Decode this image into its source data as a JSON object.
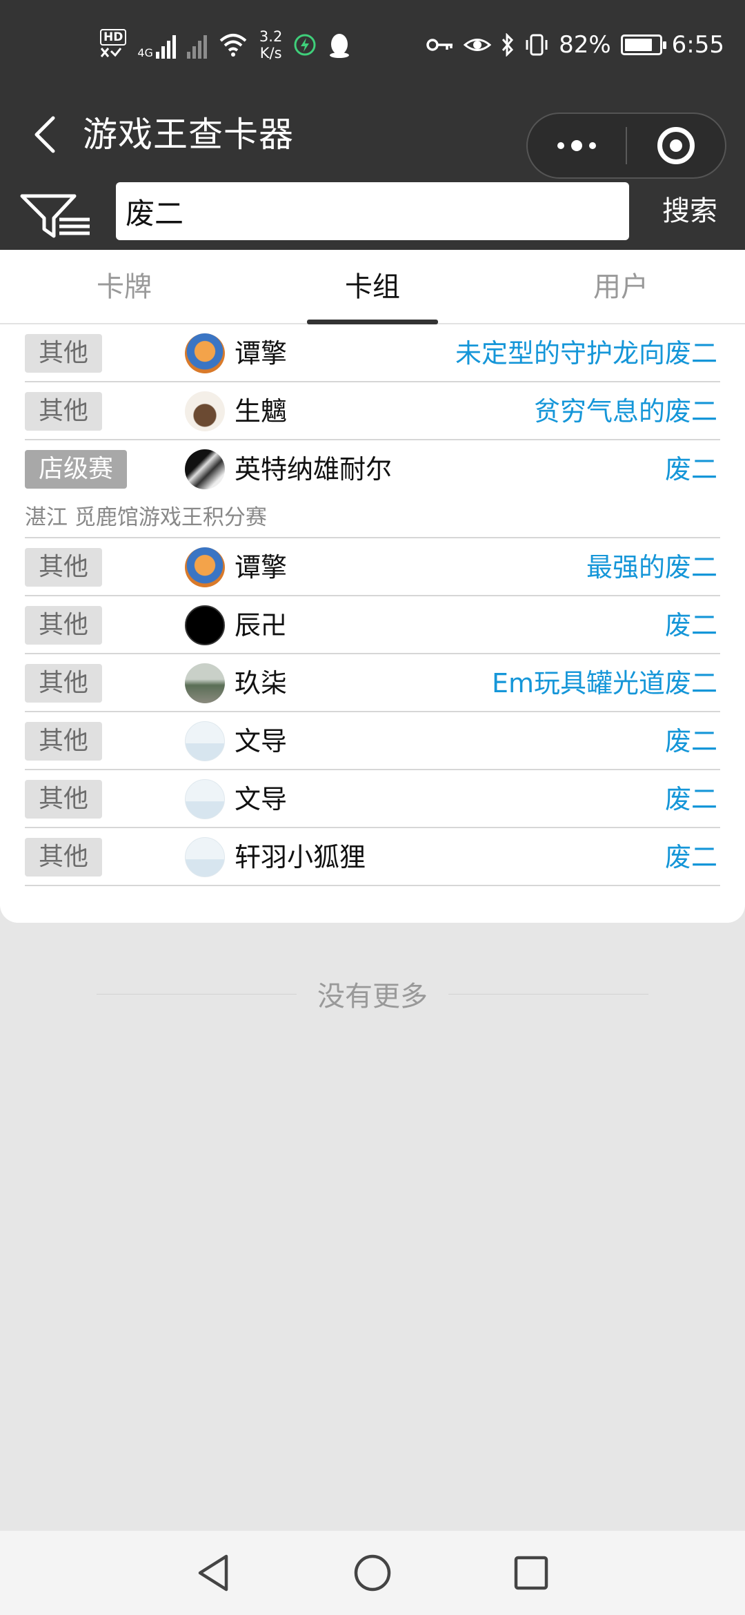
{
  "status_bar": {
    "hd_label": "HD",
    "network_label": "4G",
    "speed_value": "3.2",
    "speed_unit": "K/s",
    "battery_text": "82%",
    "battery_level": 0.82,
    "time": "6:55"
  },
  "header": {
    "title": "游戏王查卡器",
    "back_icon": "chevron-left-icon",
    "more_icon": "more-dots-icon",
    "close_icon": "target-circle-icon"
  },
  "search": {
    "query": "废二",
    "button_label": "搜索",
    "filter_icon": "filter-funnel-icon"
  },
  "tabs": [
    {
      "label": "卡牌",
      "active": false
    },
    {
      "label": "卡组",
      "active": true
    },
    {
      "label": "用户",
      "active": false
    }
  ],
  "decks": [
    {
      "tag": "其他",
      "user": "谭擎",
      "deck": "未定型的守护龙向废二",
      "avatar": "orange-warrior-avatar"
    },
    {
      "tag": "其他",
      "user": "生魑",
      "deck": "贫穷气息的废二",
      "avatar": "brown-creature-avatar"
    },
    {
      "tag": "店级赛",
      "user": "英特纳雄耐尔",
      "deck": "废二",
      "subtitle": "湛江 觅鹿馆游戏王积分赛",
      "avatar": "bw-photo-avatar"
    },
    {
      "tag": "其他",
      "user": "谭擎",
      "deck": "最强的废二",
      "avatar": "orange-warrior-avatar"
    },
    {
      "tag": "其他",
      "user": "辰卍",
      "deck": "废二",
      "avatar": "black-sketch-avatar"
    },
    {
      "tag": "其他",
      "user": "玖柒",
      "deck": "Em玩具罐光道废二",
      "avatar": "landscape-avatar"
    },
    {
      "tag": "其他",
      "user": "文导",
      "deck": "废二",
      "avatar": "default-avatar"
    },
    {
      "tag": "其他",
      "user": "文导",
      "deck": "废二",
      "avatar": "default-avatar"
    },
    {
      "tag": "其他",
      "user": "轩羽小狐狸",
      "deck": "废二",
      "avatar": "default-avatar"
    }
  ],
  "footer": {
    "no_more": "没有更多"
  },
  "colors": {
    "header_bg": "#343434",
    "link_blue": "#1596d8",
    "page_bg": "#e6e6e6"
  }
}
